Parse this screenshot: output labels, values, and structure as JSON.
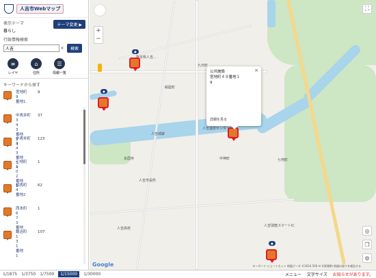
{
  "logo": {
    "text": "人吉市Webマップ"
  },
  "theme": {
    "label": "表示テーマ",
    "value": "暮らし",
    "button": "テーマ変更 ▶"
  },
  "search": {
    "label": "行政情報検索",
    "value": "人吉",
    "clear": "×",
    "button": "検索"
  },
  "tools": [
    {
      "label": "レイヤ",
      "icon": "layers-icon"
    },
    {
      "label": "住所",
      "icon": "home-icon"
    },
    {
      "label": "情報一覧",
      "icon": "list-icon"
    }
  ],
  "keyword_title": "キーワードから探す",
  "results": [
    {
      "name": "宮地町\n9\n番地1",
      "count": "9"
    },
    {
      "name": "中青井町\n3\n4\n3\n番地\n1\n4",
      "count": "37"
    },
    {
      "name": "中青井町\n3\n4\n3\n番地\n1\n4",
      "count": "123"
    },
    {
      "name": "七地町\n1\n0\n2\n番地\n1",
      "count": "1"
    },
    {
      "name": "相良町\n4\n番地2",
      "count": "62"
    },
    {
      "name": "西本町\n6\n7\n3\n番地",
      "count": "1"
    },
    {
      "name": "鍛冶町\n1\n3\n1\n番地\n1\n6",
      "count": "107"
    }
  ],
  "popup": {
    "line1": "公共施設",
    "line2": "宮地町４９番地１",
    "line3": "9",
    "link": "詳細を見る",
    "close": "×"
  },
  "map_labels": [
    {
      "text": "熊本県人吉...",
      "pos": "a"
    },
    {
      "text": "九日町",
      "pos": "b"
    },
    {
      "text": "紺屋町",
      "pos": "c"
    },
    {
      "text": "人吉城跡",
      "pos": "d"
    },
    {
      "text": "人吉市役所",
      "pos": "e"
    },
    {
      "text": "人吉温泉センター",
      "pos": "f"
    },
    {
      "text": "中神町",
      "pos": "g"
    },
    {
      "text": "七地町",
      "pos": "h"
    },
    {
      "text": "永国寺",
      "pos": "i"
    },
    {
      "text": "人吉球磨スマートIC",
      "pos": "j"
    },
    {
      "text": "人吉高校",
      "pos": "k"
    }
  ],
  "bottom": {
    "scales": [
      "1/1875",
      "1/3750",
      "1/7500",
      "1/15000",
      "1/30000"
    ],
    "active_scale": "1/15000",
    "menu": "メニュー",
    "font_size": "文字サイズ",
    "notice": "お知らせがあります。"
  },
  "google": "Google",
  "attribution": "キーボード ショートカット  地図データ ©2024  500 m  利用規約  地図の誤りを報告する",
  "colors": {
    "accent": "#1e3f7a",
    "pin": "#e07a2a",
    "notice": "#e01818"
  }
}
